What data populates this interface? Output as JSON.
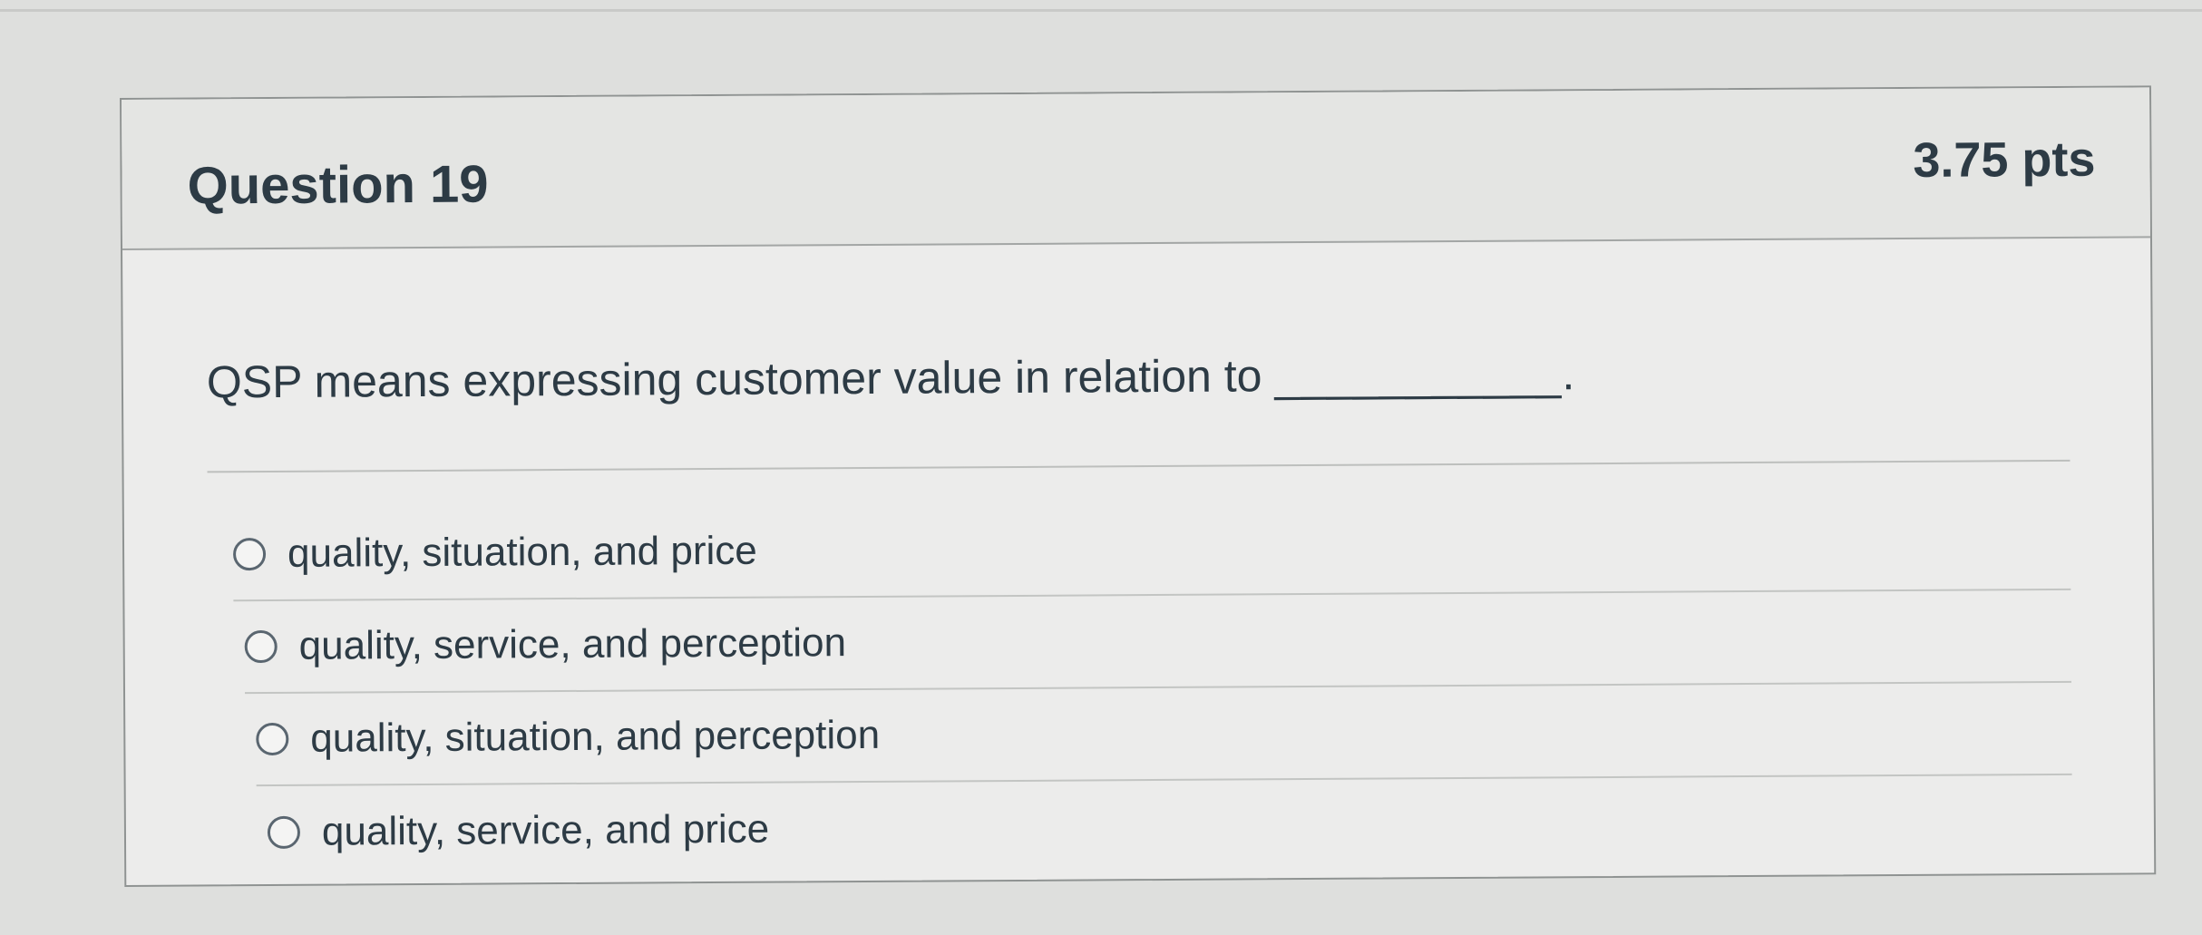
{
  "question": {
    "title": "Question 19",
    "points": "3.75 pts",
    "text": "QSP means expressing customer value in relation to",
    "blank": "___________."
  },
  "answers": [
    {
      "label": "quality, situation, and price",
      "selected": false
    },
    {
      "label": "quality, service, and perception",
      "selected": false
    },
    {
      "label": "quality, situation, and perception",
      "selected": false
    },
    {
      "label": "quality, service, and price",
      "selected": false
    }
  ]
}
